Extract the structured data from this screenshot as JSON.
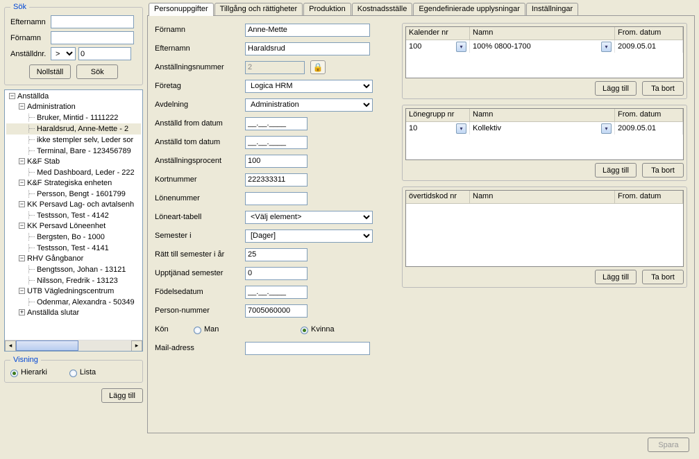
{
  "search": {
    "legend": "Sök",
    "efternamn_label": "Efternamn",
    "fornamn_label": "Förnamn",
    "anstalldnr_label": "Anställdnr.",
    "op": ">",
    "num": "0",
    "nollstall": "Nollställ",
    "sok": "Sök",
    "efternamn_val": "",
    "fornamn_val": ""
  },
  "tree": {
    "root": "Anställda",
    "branches": [
      {
        "label": "Administration",
        "items": [
          "Bruker, Mintid - 1111222",
          "Haraldsrud, Anne-Mette - 2",
          "ikke stempler selv, Leder sor",
          "Terminal, Bare - 123456789"
        ]
      },
      {
        "label": "K&F  Stab",
        "items": [
          "Med Dashboard, Leder - 222"
        ]
      },
      {
        "label": "K&F  Strategiska enheten",
        "items": [
          "Persson, Bengt - 1601799"
        ]
      },
      {
        "label": "KK  Persavd Lag- och avtalsenh",
        "items": [
          "Testsson, Test - 4142"
        ]
      },
      {
        "label": "KK  Persavd Löneenhet",
        "items": [
          "Bergsten, Bo - 1000",
          "Testsson, Test - 4141"
        ]
      },
      {
        "label": "RHV  Gångbanor",
        "items": [
          "Bengtsson, Johan - 13121",
          "Nilsson, Fredrik - 13123"
        ]
      },
      {
        "label": "UTB  Vägledningscentrum",
        "items": [
          "Odenmar, Alexandra - 50349"
        ]
      }
    ],
    "tail": "Anställda slutar",
    "selected": "Haraldsrud, Anne-Mette - 2"
  },
  "view": {
    "legend": "Visning",
    "hierarki": "Hierarki",
    "lista": "Lista"
  },
  "lagg_till": "Lägg till",
  "ta_bort": "Ta bort",
  "tabs": [
    "Personuppgifter",
    "Tillgång och rättigheter",
    "Produktion",
    "Kostnadsställe",
    "Egendefinierade upplysningar",
    "Inställningar"
  ],
  "form": {
    "fornamn_label": "Förnamn",
    "fornamn": "Anne-Mette",
    "efternamn_label": "Efternamn",
    "efternamn": "Haraldsrud",
    "anstnr_label": "Anställningsnummer",
    "anstnr": "2",
    "foretag_label": "Företag",
    "foretag": "Logica HRM",
    "avdelning_label": "Avdelning",
    "avdelning": "Administration",
    "from_label": "Anställd from datum",
    "from": "__.__.____",
    "tom_label": "Anställd tom datum",
    "tom": "__.__.____",
    "procent_label": "Anställningsprocent",
    "procent": "100",
    "kort_label": "Kortnummer",
    "kort": "222333311",
    "lone_label": "Lönenummer",
    "lone": "",
    "loneart_label": "Löneart-tabell",
    "loneart": "<Välj element>",
    "semester_label": "Semester i",
    "semester": "[Dager]",
    "ratt_label": "Rätt till semester i år",
    "ratt": "25",
    "upp_label": "Upptjänad semester",
    "upp": "0",
    "fodelse_label": "Födelsedatum",
    "fodelse": "__.__.____",
    "pnr_label": "Person-nummer",
    "pnr": "7005060000",
    "kon_label": "Kön",
    "man": "Man",
    "kvinna": "Kvinna",
    "mail_label": "Mail-adress",
    "mail": ""
  },
  "grids": {
    "kalender": {
      "h1": "Kalender nr",
      "h2": "Namn",
      "h3": "From. datum",
      "rows": [
        {
          "c1": "100",
          "c2": "100% 0800-1700",
          "c3": "2009.05.01"
        }
      ]
    },
    "lonegrupp": {
      "h1": "Lönegrupp nr",
      "h2": "Namn",
      "h3": "From. datum",
      "rows": [
        {
          "c1": "10",
          "c2": "Kollektiv",
          "c3": "2009.05.01"
        }
      ]
    },
    "overtid": {
      "h1": "övertidskod nr",
      "h2": "Namn",
      "h3": "From. datum",
      "rows": []
    }
  },
  "save": "Spara"
}
